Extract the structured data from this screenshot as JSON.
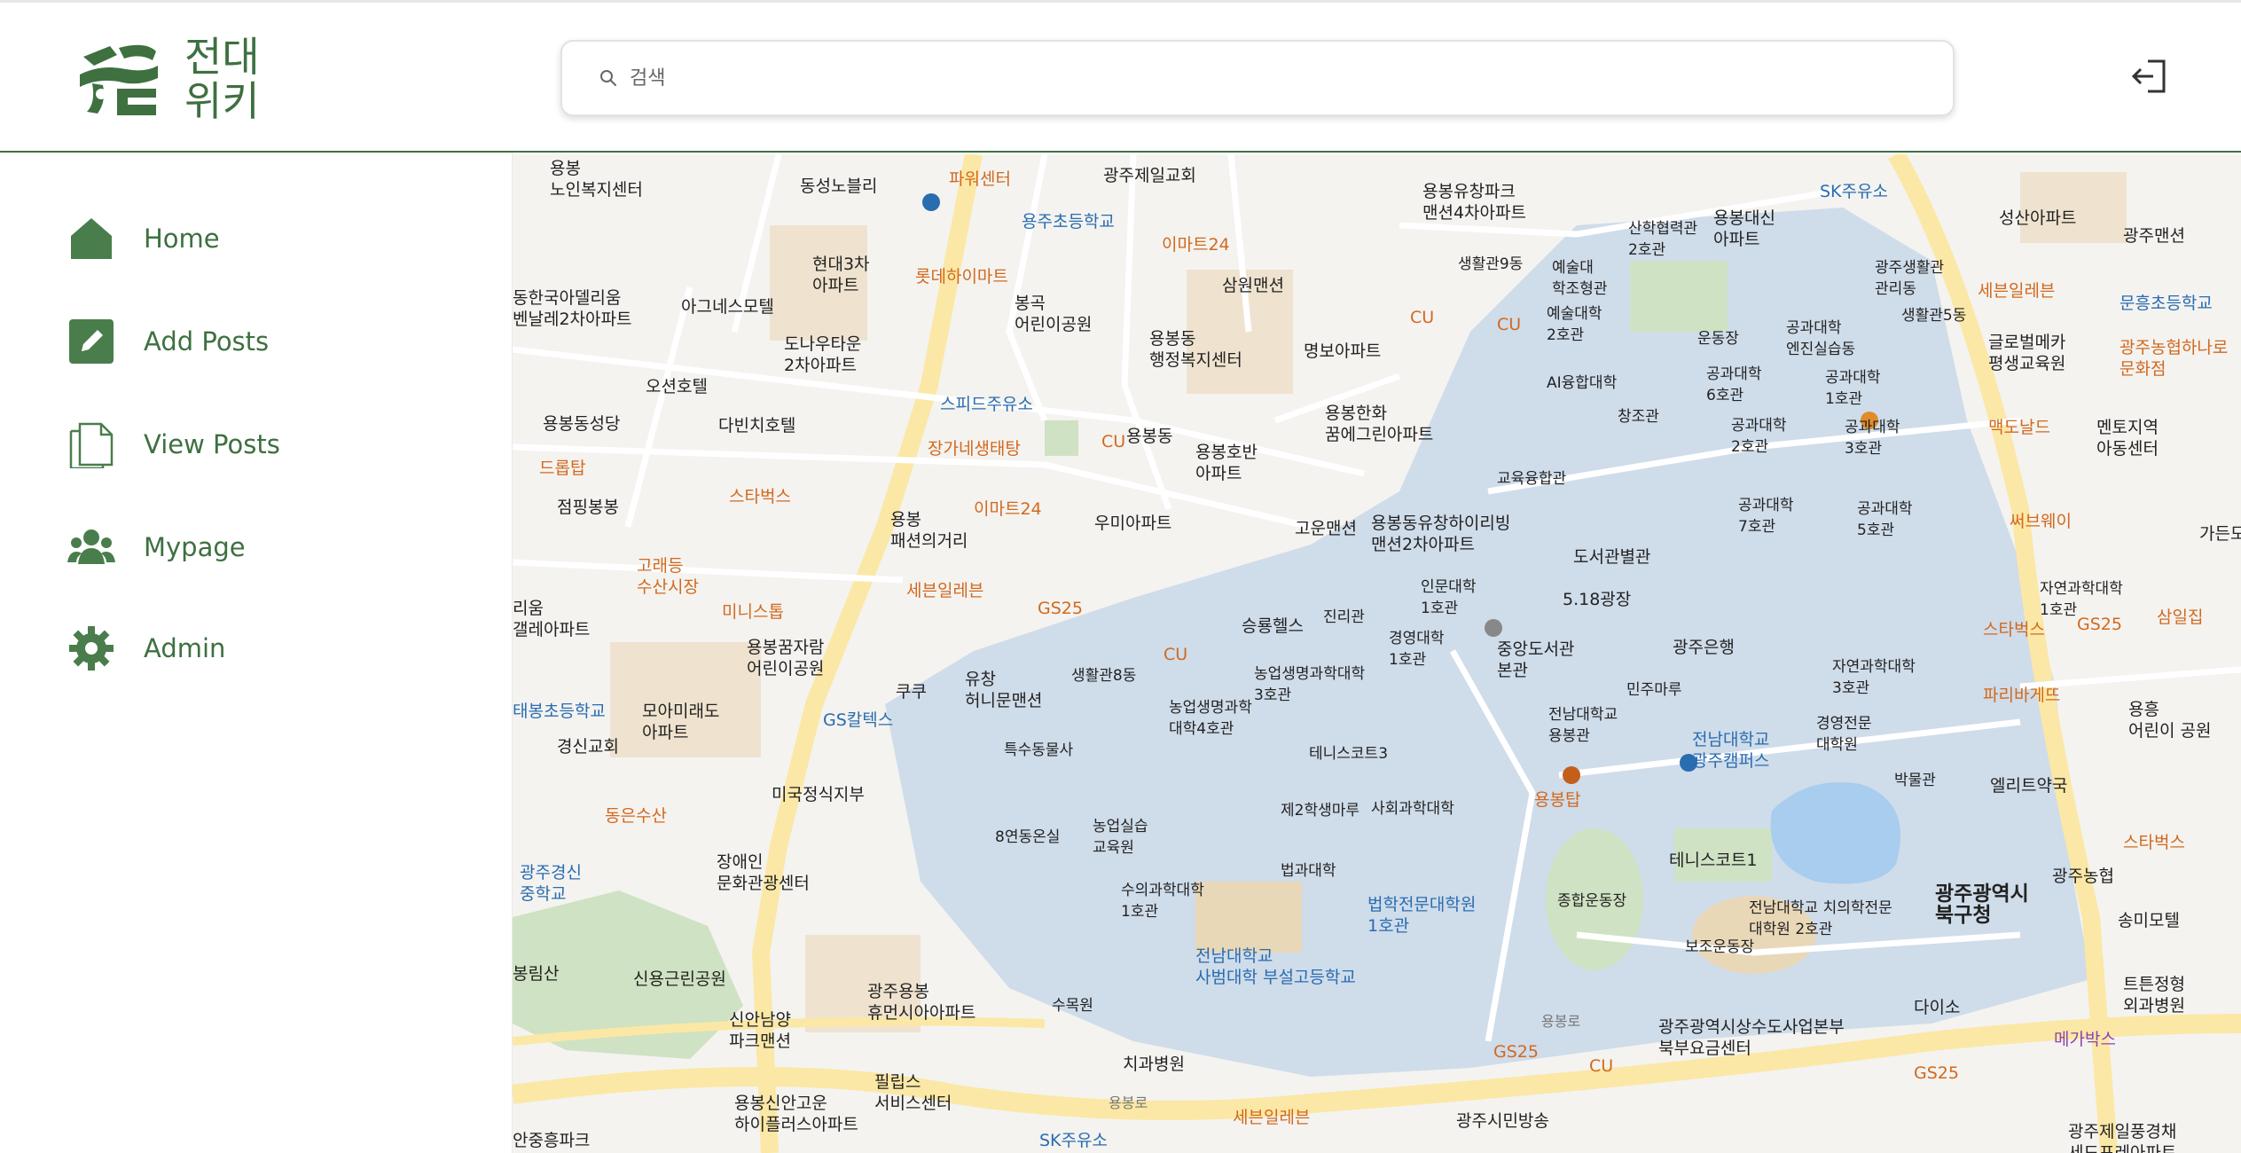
{
  "app": {
    "logo_text_line1": "전대",
    "logo_text_line2": "위키",
    "brand_color": "#3e7040",
    "logo_mark_text": "전대 위키 logo"
  },
  "search": {
    "placeholder": "검색",
    "value": ""
  },
  "header": {
    "logout_icon": "logout-icon"
  },
  "sidebar": {
    "items": [
      {
        "label": "Home",
        "icon": "home-icon"
      },
      {
        "label": "Add Posts",
        "icon": "edit-icon"
      },
      {
        "label": "View Posts",
        "icon": "document-icon"
      },
      {
        "label": "Mypage",
        "icon": "users-icon"
      },
      {
        "label": "Admin",
        "icon": "gear-icon"
      }
    ]
  },
  "map": {
    "labels": [
      {
        "text": "용봉\n노인복지센터",
        "cls": "dark"
      },
      {
        "text": "동성노블리",
        "cls": "dark"
      },
      {
        "text": "파워센터",
        "cls": "orange"
      },
      {
        "text": "광주제일교회",
        "cls": "dark"
      },
      {
        "text": "용봉유창파크\n맨션4차아파트",
        "cls": "dark"
      },
      {
        "text": "산학협력관\n2호관",
        "cls": "dark"
      },
      {
        "text": "용봉대신\n아파트",
        "cls": "dark"
      },
      {
        "text": "SK주유소",
        "cls": "blue"
      },
      {
        "text": "성산아파트",
        "cls": "dark"
      },
      {
        "text": "광주맨션",
        "cls": "dark"
      },
      {
        "text": "용주초등학교",
        "cls": "blue"
      },
      {
        "text": "이마트24",
        "cls": "orange"
      },
      {
        "text": "현대3차\n아파트",
        "cls": "dark"
      },
      {
        "text": "롯데하이마트",
        "cls": "orange"
      },
      {
        "text": "삼원맨션",
        "cls": "dark"
      },
      {
        "text": "생활관9동",
        "cls": "dark"
      },
      {
        "text": "예술대\n학조형관",
        "cls": "dark"
      },
      {
        "text": "광주생활관\n관리동",
        "cls": "dark"
      },
      {
        "text": "세븐일레븐",
        "cls": "orange"
      },
      {
        "text": "문흥초등학교",
        "cls": "blue"
      },
      {
        "text": "동한국아델리움\n벤날레2차아파트",
        "cls": "dark"
      },
      {
        "text": "아그네스모텔",
        "cls": "dark"
      },
      {
        "text": "봉곡\n어린이공원",
        "cls": "dark"
      },
      {
        "text": "용봉동\n행정복지센터",
        "cls": "dark"
      },
      {
        "text": "CU",
        "cls": "orange"
      },
      {
        "text": "CU",
        "cls": "orange"
      },
      {
        "text": "예술대학\n2호관",
        "cls": "dark"
      },
      {
        "text": "운동장",
        "cls": "dark"
      },
      {
        "text": "공과대학\n엔진실습동",
        "cls": "dark"
      },
      {
        "text": "생활관5동",
        "cls": "dark"
      },
      {
        "text": "글로벌메카\n평생교육원",
        "cls": "dark"
      },
      {
        "text": "광주농협하나로\n문화점",
        "cls": "orange"
      },
      {
        "text": "도나우타운\n2차아파트",
        "cls": "dark"
      },
      {
        "text": "명보아파트",
        "cls": "dark"
      },
      {
        "text": "AI융합대학",
        "cls": "dark"
      },
      {
        "text": "공과대학\n6호관",
        "cls": "dark"
      },
      {
        "text": "공과대학\n1호관",
        "cls": "dark"
      },
      {
        "text": "오션호텔",
        "cls": "dark"
      },
      {
        "text": "스피드주유소",
        "cls": "blue"
      },
      {
        "text": "다빈치호텔",
        "cls": "dark"
      },
      {
        "text": "용봉한화\n꿈에그린아파트",
        "cls": "dark"
      },
      {
        "text": "창조관",
        "cls": "dark"
      },
      {
        "text": "공과대학\n2호관",
        "cls": "dark"
      },
      {
        "text": "공과대학\n3호관",
        "cls": "dark"
      },
      {
        "text": "맥도날드",
        "cls": "orange"
      },
      {
        "text": "멘토지역\n아동센터",
        "cls": "dark"
      },
      {
        "text": "용봉동성당",
        "cls": "dark"
      },
      {
        "text": "장가네생태탕",
        "cls": "orange"
      },
      {
        "text": "CU",
        "cls": "orange"
      },
      {
        "text": "용봉동",
        "cls": "dark"
      },
      {
        "text": "용봉호반\n아파트",
        "cls": "dark"
      },
      {
        "text": "드롭탑",
        "cls": "orange"
      },
      {
        "text": "스타벅스",
        "cls": "orange"
      },
      {
        "text": "교육융합관",
        "cls": "dark"
      },
      {
        "text": "공과대학\n7호관",
        "cls": "dark"
      },
      {
        "text": "공과대학\n5호관",
        "cls": "dark"
      },
      {
        "text": "점핑봉봉",
        "cls": "dark"
      },
      {
        "text": "용봉\n패션의거리",
        "cls": "dark"
      },
      {
        "text": "이마트24",
        "cls": "orange"
      },
      {
        "text": "우미아파트",
        "cls": "dark"
      },
      {
        "text": "고운맨션",
        "cls": "dark"
      },
      {
        "text": "용봉동유창하이리빙\n맨션2차아파트",
        "cls": "dark"
      },
      {
        "text": "써브웨이",
        "cls": "orange"
      },
      {
        "text": "가든모",
        "cls": "dark"
      },
      {
        "text": "고래등\n수산시장",
        "cls": "orange"
      },
      {
        "text": "도서관별관",
        "cls": "dark"
      },
      {
        "text": "세븐일레븐",
        "cls": "orange"
      },
      {
        "text": "GS25",
        "cls": "orange"
      },
      {
        "text": "인문대학\n1호관",
        "cls": "dark"
      },
      {
        "text": "5.18광장",
        "cls": "dark"
      },
      {
        "text": "자연과학대학\n1호관",
        "cls": "dark"
      },
      {
        "text": "미니스톱",
        "cls": "orange"
      },
      {
        "text": "진리관",
        "cls": "dark"
      },
      {
        "text": "승룡헬스",
        "cls": "dark"
      },
      {
        "text": "삼일집",
        "cls": "orange"
      },
      {
        "text": "리움\n갤레아파트",
        "cls": "dark"
      },
      {
        "text": "용봉꿈자람\n어린이공원",
        "cls": "dark"
      },
      {
        "text": "CU",
        "cls": "orange"
      },
      {
        "text": "경영대학\n1호관",
        "cls": "dark"
      },
      {
        "text": "중앙도서관\n본관",
        "cls": "dark"
      },
      {
        "text": "광주은행",
        "cls": "dark"
      },
      {
        "text": "스타벅스",
        "cls": "orange"
      },
      {
        "text": "GS25",
        "cls": "orange"
      },
      {
        "text": "쿠쿠",
        "cls": "dark"
      },
      {
        "text": "생활관8동",
        "cls": "dark"
      },
      {
        "text": "농업생명과학대학\n3호관",
        "cls": "dark"
      },
      {
        "text": "자연과학대학\n3호관",
        "cls": "dark"
      },
      {
        "text": "유창\n허니문맨션",
        "cls": "dark"
      },
      {
        "text": "민주마루",
        "cls": "dark"
      },
      {
        "text": "파리바게뜨",
        "cls": "orange"
      },
      {
        "text": "태봉초등학교",
        "cls": "blue"
      },
      {
        "text": "모아미래도\n아파트",
        "cls": "dark"
      },
      {
        "text": "GS칼텍스",
        "cls": "blue"
      },
      {
        "text": "농업생명과학\n대학4호관",
        "cls": "dark"
      },
      {
        "text": "전남대학교\n용봉관",
        "cls": "dark"
      },
      {
        "text": "전남대학교\n광주캠퍼스",
        "cls": "blue"
      },
      {
        "text": "경영전문\n대학원",
        "cls": "dark"
      },
      {
        "text": "용흥\n어린이 공원",
        "cls": "dark"
      },
      {
        "text": "경신교회",
        "cls": "dark"
      },
      {
        "text": "특수동물사",
        "cls": "dark"
      },
      {
        "text": "테니스코트3",
        "cls": "dark"
      },
      {
        "text": "용봉탑",
        "cls": "orange"
      },
      {
        "text": "박물관",
        "cls": "dark"
      },
      {
        "text": "엘리트약국",
        "cls": "dark"
      },
      {
        "text": "미국정식지부",
        "cls": "dark"
      },
      {
        "text": "동은수산",
        "cls": "orange"
      },
      {
        "text": "8연동온실",
        "cls": "dark"
      },
      {
        "text": "농업실습\n교육원",
        "cls": "dark"
      },
      {
        "text": "제2학생마루",
        "cls": "dark"
      },
      {
        "text": "사회과학대학",
        "cls": "dark"
      },
      {
        "text": "스타벅스",
        "cls": "orange"
      },
      {
        "text": "장애인\n문화관광센터",
        "cls": "dark"
      },
      {
        "text": "테니스코트1",
        "cls": "dark"
      },
      {
        "text": "광주경신\n중학교",
        "cls": "blue"
      },
      {
        "text": "법과대학",
        "cls": "dark"
      },
      {
        "text": "종합운동장",
        "cls": "dark"
      },
      {
        "text": "광주농협",
        "cls": "dark"
      },
      {
        "text": "광주광역시\n북구청",
        "cls": "dark"
      },
      {
        "text": "수의과학대학\n1호관",
        "cls": "dark"
      },
      {
        "text": "법학전문대학원\n1호관",
        "cls": "blue"
      },
      {
        "text": "전남대학교 치의학전문\n대학원 2호관",
        "cls": "dark"
      },
      {
        "text": "송미모텔",
        "cls": "dark"
      },
      {
        "text": "봉림산",
        "cls": "dark"
      },
      {
        "text": "신용근린공원",
        "cls": "dark"
      },
      {
        "text": "전남대학교\n사범대학 부설고등학교",
        "cls": "blue"
      },
      {
        "text": "보조운동장",
        "cls": "dark"
      },
      {
        "text": "광주용봉\n휴먼시아아파트",
        "cls": "dark"
      },
      {
        "text": "다이소",
        "cls": "dark"
      },
      {
        "text": "트튼정형\n외과병원",
        "cls": "dark"
      },
      {
        "text": "신안남양\n파크맨션",
        "cls": "dark"
      },
      {
        "text": "수목원",
        "cls": "dark"
      },
      {
        "text": "용봉로",
        "cls": "road"
      },
      {
        "text": "광주광역시상수도사업본부\n북부요금센터",
        "cls": "dark"
      },
      {
        "text": "메가박스",
        "cls": "purple"
      },
      {
        "text": "치과병원",
        "cls": "dark"
      },
      {
        "text": "GS25",
        "cls": "orange"
      },
      {
        "text": "CU",
        "cls": "orange"
      },
      {
        "text": "GS25",
        "cls": "orange"
      },
      {
        "text": "필립스\n서비스센터",
        "cls": "dark"
      },
      {
        "text": "용봉로",
        "cls": "road"
      },
      {
        "text": "용봉신안고운\n하이플러스아파트",
        "cls": "dark"
      },
      {
        "text": "세븐일레븐",
        "cls": "orange"
      },
      {
        "text": "광주시민방송",
        "cls": "dark"
      },
      {
        "text": "SK주유소",
        "cls": "blue"
      },
      {
        "text": "안중흥파크",
        "cls": "dark"
      },
      {
        "text": "광주제일풍경채\n세드포레아파트",
        "cls": "dark"
      }
    ]
  }
}
